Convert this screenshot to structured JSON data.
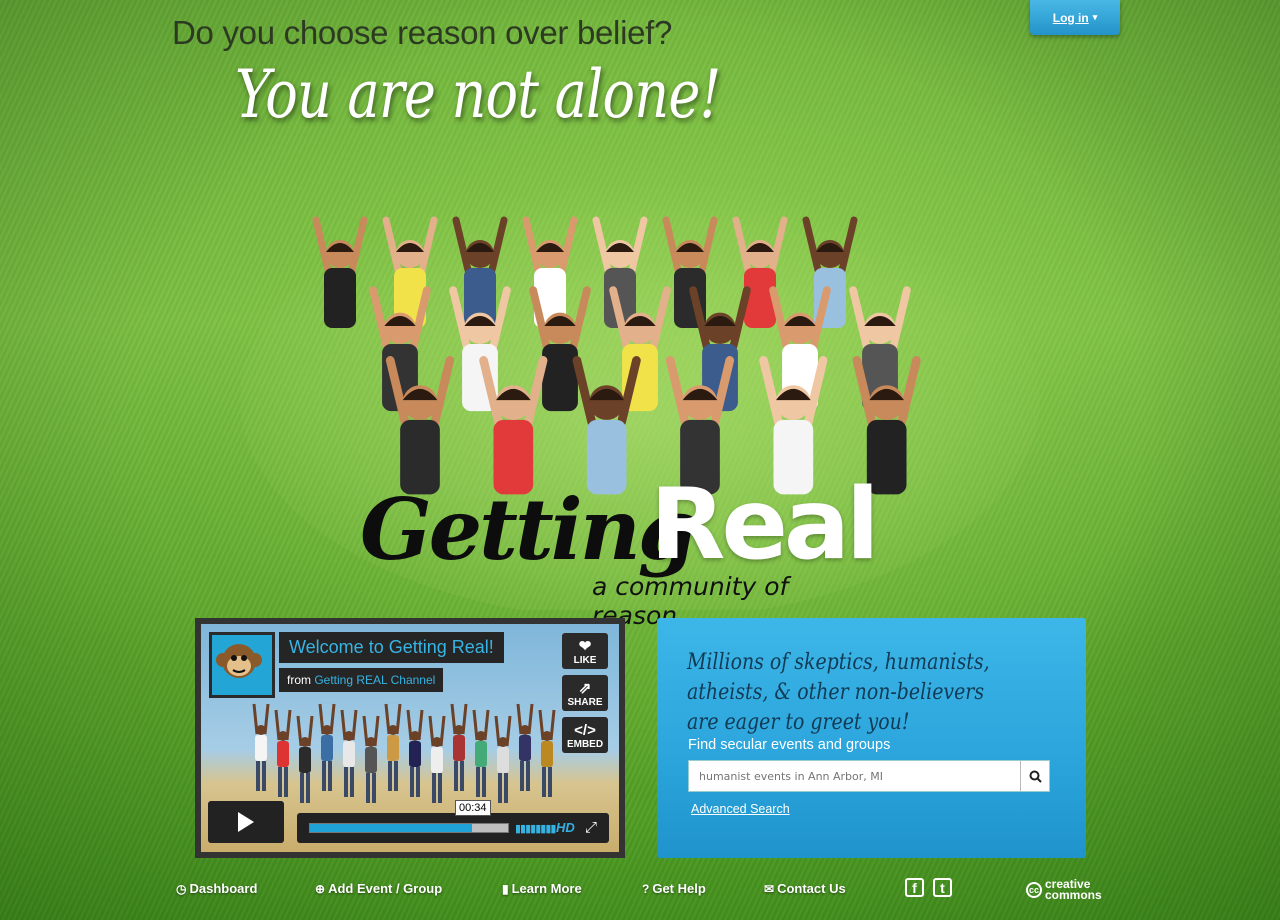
{
  "header": {
    "tagline": "Do you choose reason over belief?",
    "headline": "You are not alone!",
    "login": {
      "label": "Log in",
      "icon": "chevron-down-icon"
    }
  },
  "logo": {
    "word1": "Getting",
    "word2": "Real",
    "subtitle": "a community of reason"
  },
  "video": {
    "title": "Welcome to Getting Real!",
    "from_label": "from",
    "channel": "Getting REAL Channel",
    "buttons": {
      "like": "LIKE",
      "share": "SHARE",
      "embed": "EMBED"
    },
    "timecode": "00:34",
    "progress": 0.82,
    "hd": "HD"
  },
  "search": {
    "promo": "Millions of skeptics, humanists, atheists, & other non-believers are eager to greet you!",
    "label": "Find secular events and groups",
    "placeholder": "humanist events in Ann Arbor, MI",
    "advanced": "Advanced Search"
  },
  "footer": {
    "items": [
      {
        "label": "Dashboard",
        "icon": "dashboard-icon"
      },
      {
        "label": "Add Event / Group",
        "icon": "plus-circle-icon"
      },
      {
        "label": "Learn More",
        "icon": "book-icon"
      },
      {
        "label": "Get Help",
        "icon": "question-icon"
      },
      {
        "label": "Contact Us",
        "icon": "envelope-icon"
      }
    ],
    "social": [
      "facebook-icon",
      "twitter-icon"
    ],
    "cc_line1": "creative",
    "cc_line2": "commons",
    "cc_mark": "cc"
  },
  "colors": {
    "accent": "#2aa4db",
    "brand_blue": "#36b4e4",
    "grass": "#6fb43a"
  }
}
